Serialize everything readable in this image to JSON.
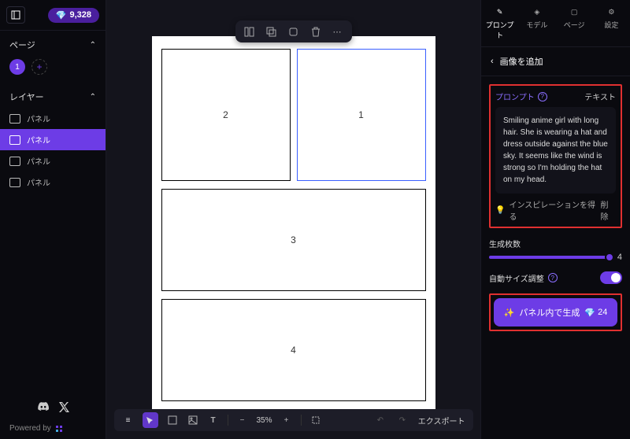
{
  "header": {
    "credits": "9,328"
  },
  "left": {
    "page_section": "ページ",
    "page_number": "1",
    "layer_section": "レイヤー",
    "layers": [
      "パネル",
      "パネル",
      "パネル",
      "パネル"
    ],
    "powered": "Powered by"
  },
  "canvas": {
    "panels": [
      "2",
      "1",
      "3",
      "4"
    ]
  },
  "bottombar": {
    "zoom": "35%",
    "export": "エクスポート"
  },
  "tabs": {
    "prompt": "プロンプト",
    "model": "モデル",
    "page": "ページ",
    "settings": "設定"
  },
  "right": {
    "back": "画像を追加",
    "prompt_label": "プロンプト",
    "text_label": "テキスト",
    "prompt_value": "Smiling anime girl with long hair. She is wearing a hat and dress outside against the blue sky. It seems like the wind is strong so I'm holding the hat on my head.",
    "inspiration": "インスピレーションを得る",
    "delete": "削除",
    "count_label": "生成枚数",
    "count_value": "4",
    "autosize_label": "自動サイズ調整",
    "generate": "パネル内で生成",
    "gen_cost": "24"
  }
}
